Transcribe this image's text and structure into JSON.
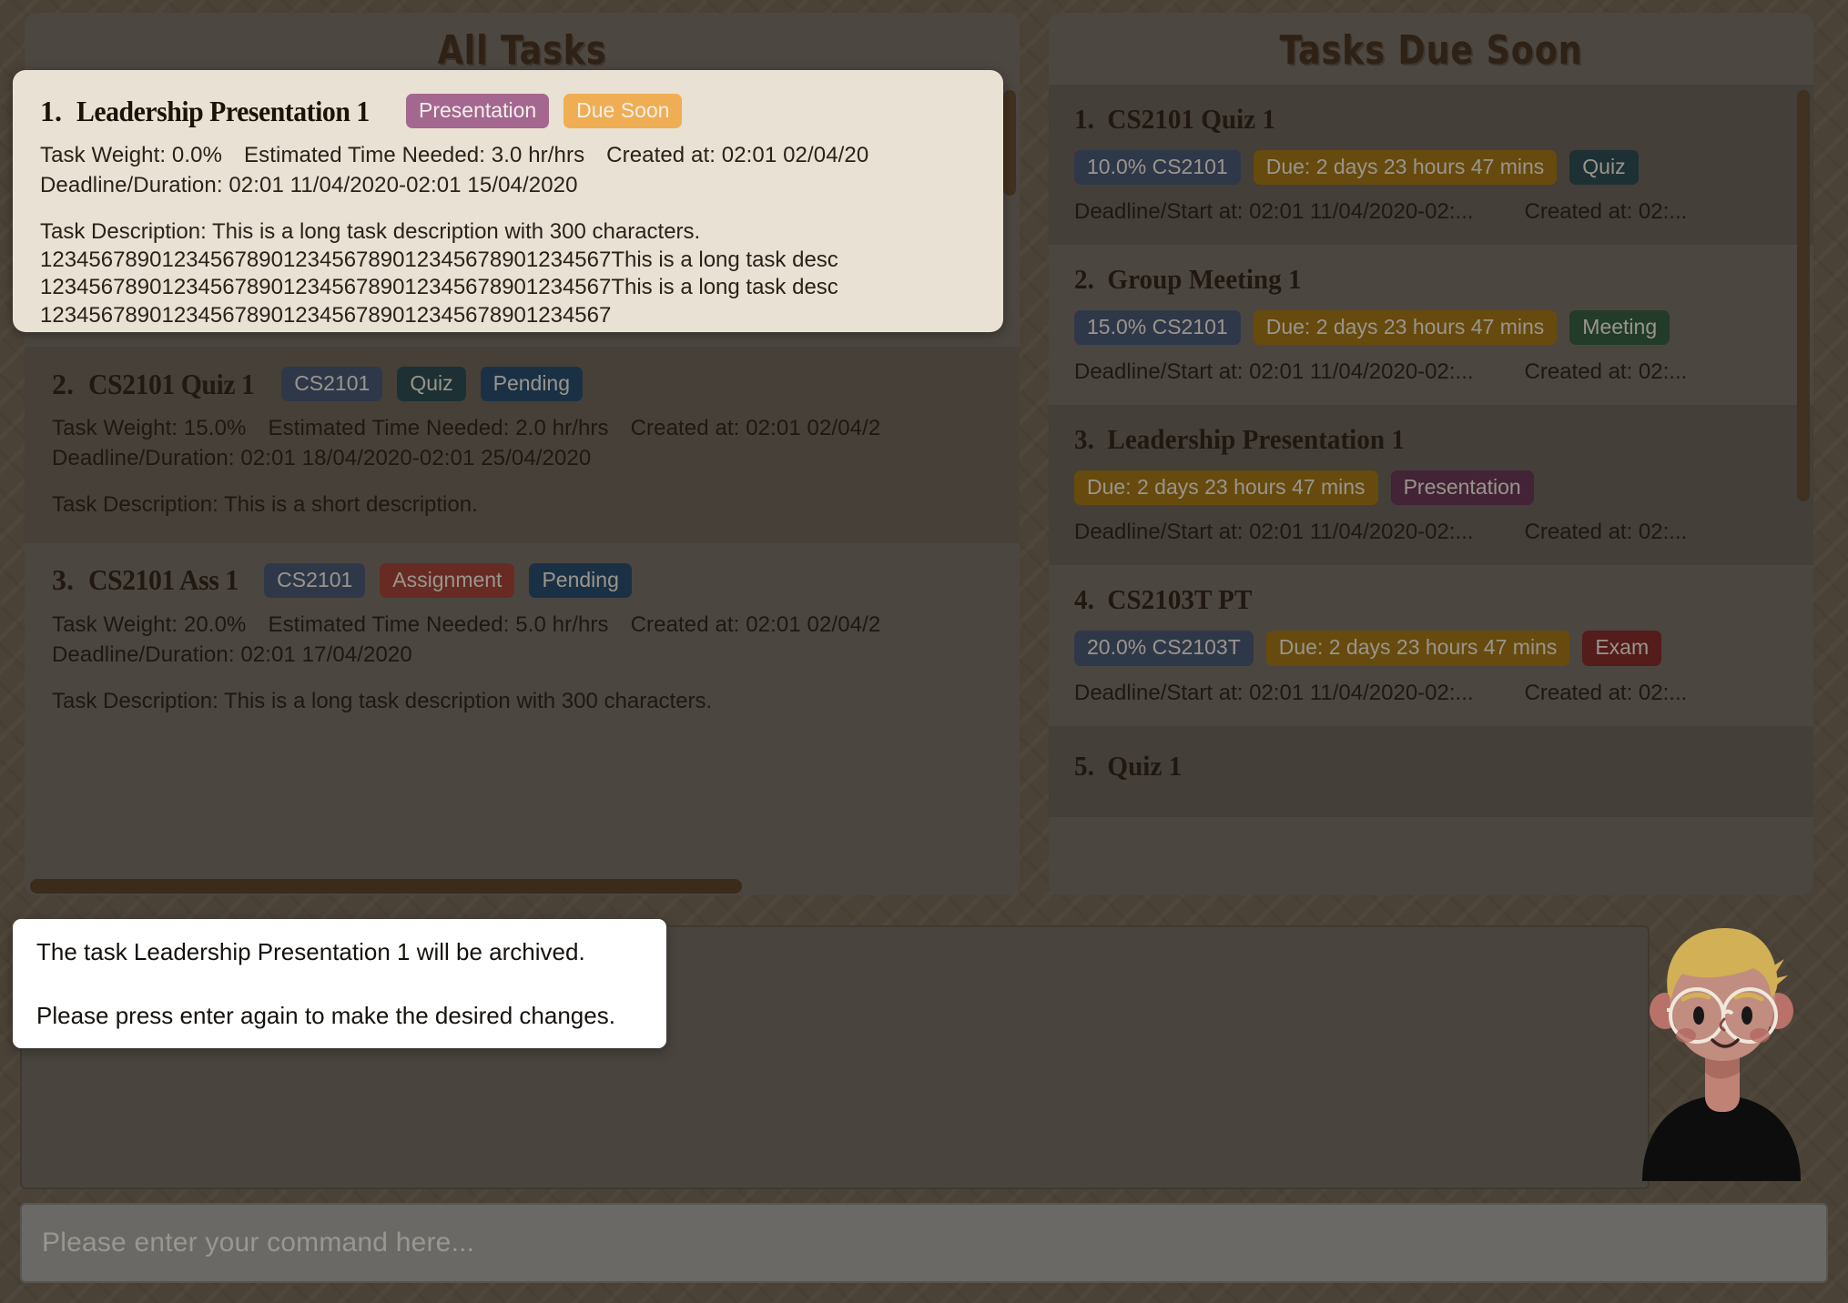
{
  "colors": {
    "background": "#6b6356",
    "panel": "#6d6a66",
    "selected_card_bg": "#e9e2d4",
    "tag_presentation": "#a4678f",
    "tag_due_soon": "#efae54",
    "tag_module": "#3c5175",
    "tag_quiz": "#1d4450",
    "tag_pending": "#17456e",
    "tag_assignment": "#9c3b35",
    "tag_meeting": "#26573f",
    "tag_exam": "#7a2126",
    "tag_due_countdown": "#9b7010",
    "scrollbar": "#5a4630"
  },
  "left_panel": {
    "title": "All Tasks",
    "selected_task": {
      "index": "1.",
      "name": "Leadership Presentation 1",
      "tags": [
        {
          "label": "Presentation",
          "color": "#a4678f"
        },
        {
          "label": "Due Soon",
          "color": "#efae54"
        }
      ],
      "weight": "Task Weight: 0.0%",
      "estimated_time": "Estimated Time Needed: 3.0 hr/hrs",
      "created_at": "Created at: 02:01 02/04/20",
      "deadline": "Deadline/Duration: 02:01 11/04/2020-02:01 15/04/2020",
      "description_lines": [
        "Task Description: This is a long task description with 300 characters.",
        "12345678901234567890123456789012345678901234567This is a long task desc",
        "12345678901234567890123456789012345678901234567This is a long task desc",
        "12345678901234567890123456789012345678901234567"
      ]
    },
    "tasks": [
      {
        "index": "2.",
        "name": "CS2101 Quiz 1",
        "tags": [
          {
            "label": "CS2101",
            "color": "#3c5175"
          },
          {
            "label": "Quiz",
            "color": "#1d4450"
          },
          {
            "label": "Pending",
            "color": "#17456e"
          }
        ],
        "weight": "Task Weight: 15.0%",
        "estimated_time": "Estimated Time Needed: 2.0 hr/hrs",
        "created_at": "Created at: 02:01 02/04/2",
        "deadline": "Deadline/Duration: 02:01 18/04/2020-02:01 25/04/2020",
        "description_lines": [
          "Task Description: This is a short description."
        ]
      },
      {
        "index": "3.",
        "name": "CS2101 Ass 1",
        "tags": [
          {
            "label": "CS2101",
            "color": "#3c5175"
          },
          {
            "label": "Assignment",
            "color": "#9c3b35"
          },
          {
            "label": "Pending",
            "color": "#17456e"
          }
        ],
        "weight": "Task Weight: 20.0%",
        "estimated_time": "Estimated Time Needed: 5.0 hr/hrs",
        "created_at": "Created at: 02:01 02/04/2",
        "deadline": "Deadline/Duration: 02:01 17/04/2020",
        "description_lines": [
          "Task Description: This is a long task description with 300 characters."
        ]
      }
    ]
  },
  "right_panel": {
    "title": "Tasks Due Soon",
    "tasks": [
      {
        "index": "1.",
        "name": "CS2101 Quiz 1",
        "tags": [
          {
            "label": "10.0% CS2101",
            "color": "#3c5175"
          },
          {
            "label": "Due: 2 days 23 hours 47 mins",
            "color": "#9b7010"
          },
          {
            "label": "Quiz",
            "color": "#1d4450"
          }
        ],
        "deadline": "Deadline/Start at: 02:01 11/04/2020-02:...",
        "created_at": "Created at: 02:..."
      },
      {
        "index": "2.",
        "name": "Group Meeting 1",
        "tags": [
          {
            "label": "15.0% CS2101",
            "color": "#3c5175"
          },
          {
            "label": "Due: 2 days 23 hours 47 mins",
            "color": "#9b7010"
          },
          {
            "label": "Meeting",
            "color": "#26573f"
          }
        ],
        "deadline": "Deadline/Start at: 02:01 11/04/2020-02:...",
        "created_at": "Created at: 02:..."
      },
      {
        "index": "3.",
        "name": "Leadership Presentation 1",
        "tags": [
          {
            "label": "Due: 2 days 23 hours 47 mins",
            "color": "#9b7010"
          },
          {
            "label": "Presentation",
            "color": "#5d2e55"
          }
        ],
        "deadline": "Deadline/Start at: 02:01 11/04/2020-02:...",
        "created_at": "Created at: 02:..."
      },
      {
        "index": "4.",
        "name": "CS2103T PT",
        "tags": [
          {
            "label": "20.0% CS2103T",
            "color": "#3c5175"
          },
          {
            "label": "Due: 2 days 23 hours 47 mins",
            "color": "#9b7010"
          },
          {
            "label": "Exam",
            "color": "#7a2126"
          }
        ],
        "deadline": "Deadline/Start at: 02:01 11/04/2020-02:...",
        "created_at": "Created at: 02:..."
      },
      {
        "index": "5.",
        "name": "Quiz 1",
        "tags": [],
        "deadline": "",
        "created_at": ""
      }
    ]
  },
  "popup": {
    "line1": "The task Leadership Presentation 1 will be archived.",
    "line2": "Please press enter again to make the desired changes."
  },
  "command_bar": {
    "placeholder": "Please enter your command here...",
    "value": ""
  },
  "avatar": {
    "name": "assistant-avatar",
    "hair_color": "#d2b055",
    "skin_color": "#c98a7e",
    "shirt_color": "#0d0d0d"
  }
}
